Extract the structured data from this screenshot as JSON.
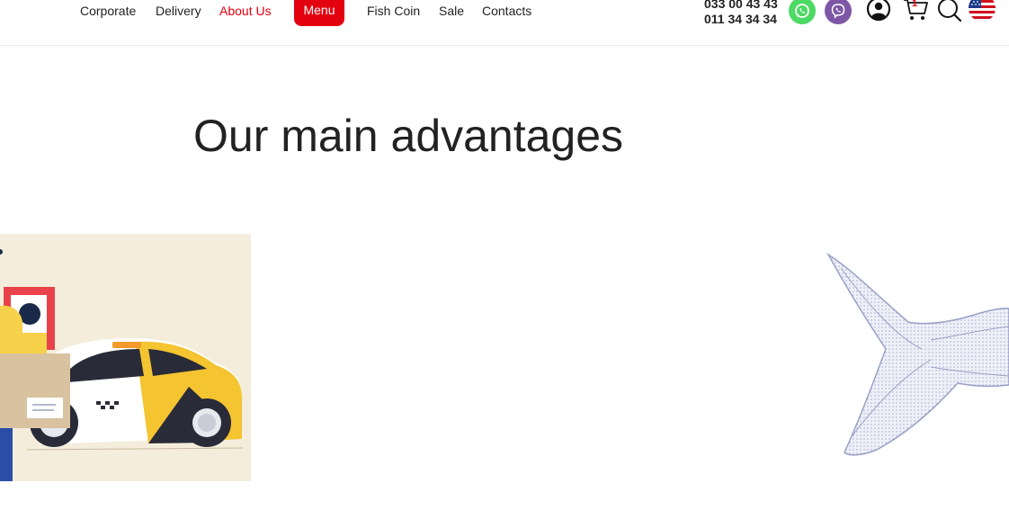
{
  "nav": {
    "items": [
      {
        "label": "Corporate",
        "active": false
      },
      {
        "label": "Delivery",
        "active": false
      },
      {
        "label": "About Us",
        "active": true
      },
      {
        "label": "Fish Coin",
        "active": false
      },
      {
        "label": "Sale",
        "active": false
      },
      {
        "label": "Contacts",
        "active": false
      }
    ],
    "menu_label": "Menu"
  },
  "contacts": {
    "phone1": "033 00 43 43",
    "phone2": "011 34 34 34"
  },
  "icons": {
    "whatsapp": "whatsapp-icon",
    "viber": "viber-icon",
    "account": "user-icon",
    "cart": "cart-icon",
    "search": "search-icon",
    "language": "us-flag-icon"
  },
  "cart": {
    "count": "1"
  },
  "main": {
    "heading": "Our main advantages"
  },
  "colors": {
    "accent": "#e3000f",
    "whatsapp": "#4cd964",
    "viber": "#7d57a6",
    "illustration_bg": "#f4eddc",
    "fish": "#a3a9cb"
  }
}
